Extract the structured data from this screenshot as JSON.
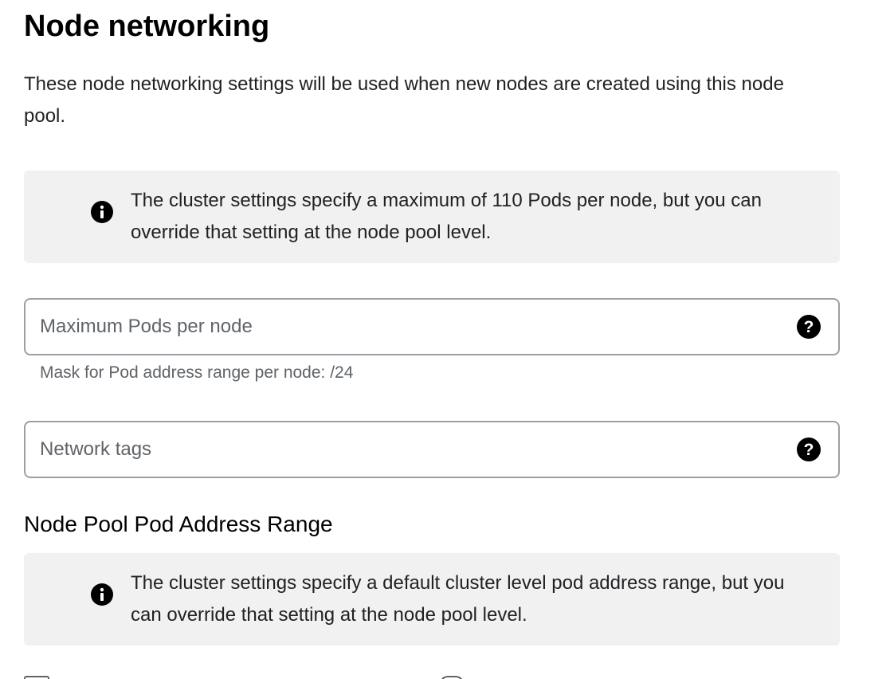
{
  "section": {
    "title": "Node networking",
    "description": "These node networking settings will be used when new nodes are created using this node pool."
  },
  "banner_pods": {
    "icon": "info-icon",
    "text": "The cluster settings specify a maximum of 110 Pods per node, but you can override that setting at the node pool level."
  },
  "max_pods_field": {
    "placeholder": "Maximum Pods per node",
    "value": "",
    "help_icon": "help-icon",
    "hint": "Mask for Pod address range per node: /24"
  },
  "network_tags_field": {
    "placeholder": "Network tags",
    "value": "",
    "help_icon": "help-icon"
  },
  "pod_address_range": {
    "heading": "Node Pool Pod Address Range",
    "banner_icon": "info-icon",
    "banner_text": "The cluster settings specify a default cluster level pod address range, but you can override that setting at the node pool level."
  },
  "colors": {
    "banner_bg": "#f1f1f1",
    "field_border": "#9aa0a6",
    "hint_text": "#5f6368"
  }
}
